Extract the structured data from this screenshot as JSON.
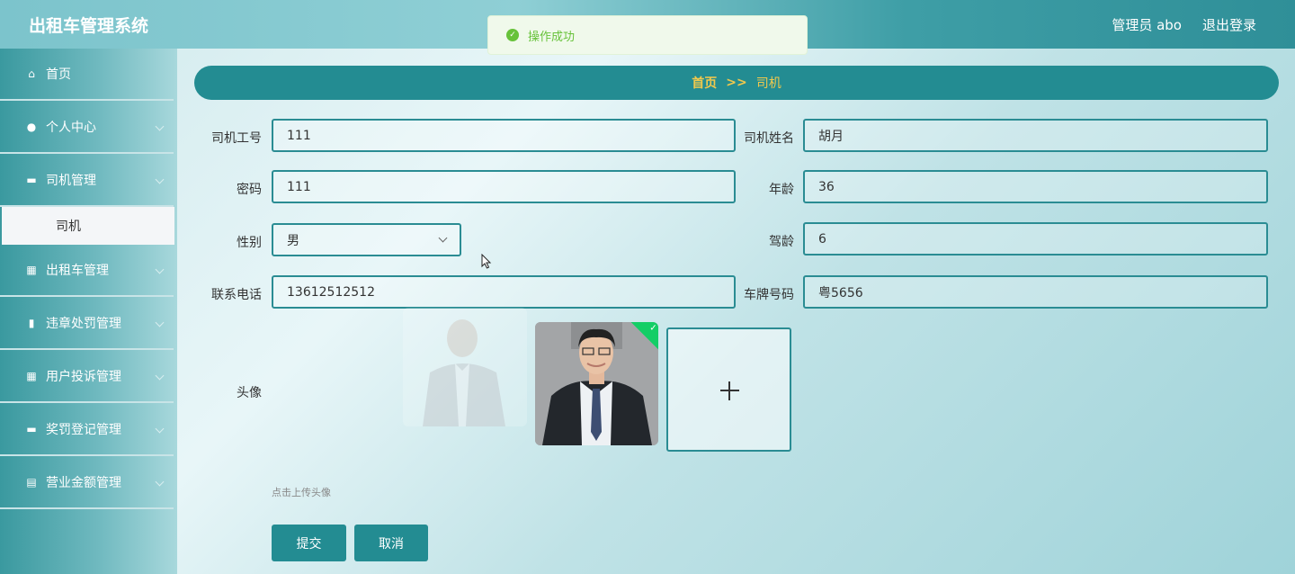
{
  "header": {
    "app_title": "出租车管理系统",
    "user": "管理员 abo",
    "logout": "退出登录"
  },
  "toast": {
    "message": "操作成功"
  },
  "sidebar": {
    "items": [
      {
        "label": "首页",
        "icon": "home-icon"
      },
      {
        "label": "个人中心",
        "icon": "user-icon"
      },
      {
        "label": "司机管理",
        "icon": "monitor-icon"
      },
      {
        "label": "出租车管理",
        "icon": "grid-icon"
      },
      {
        "label": "违章处罚管理",
        "icon": "bar-chart-icon"
      },
      {
        "label": "用户投诉管理",
        "icon": "grid-icon"
      },
      {
        "label": "奖罚登记管理",
        "icon": "printer-icon"
      },
      {
        "label": "营业金额管理",
        "icon": "clipboard-icon"
      }
    ],
    "active_sub": "司机"
  },
  "breadcrumb": {
    "home": "首页",
    "sep": ">>",
    "current": "司机"
  },
  "form": {
    "driver_no": {
      "label": "司机工号",
      "value": "111"
    },
    "driver_name": {
      "label": "司机姓名",
      "value": "胡月"
    },
    "password": {
      "label": "密码",
      "value": "111"
    },
    "age": {
      "label": "年龄",
      "value": "36"
    },
    "gender": {
      "label": "性别",
      "value": "男"
    },
    "driving_years": {
      "label": "驾龄",
      "value": "6"
    },
    "phone": {
      "label": "联系电话",
      "value": "13612512512"
    },
    "plate": {
      "label": "车牌号码",
      "value": "粤5656"
    },
    "avatar": {
      "label": "头像",
      "hint": "点击上传头像"
    }
  },
  "buttons": {
    "submit": "提交",
    "cancel": "取消"
  }
}
